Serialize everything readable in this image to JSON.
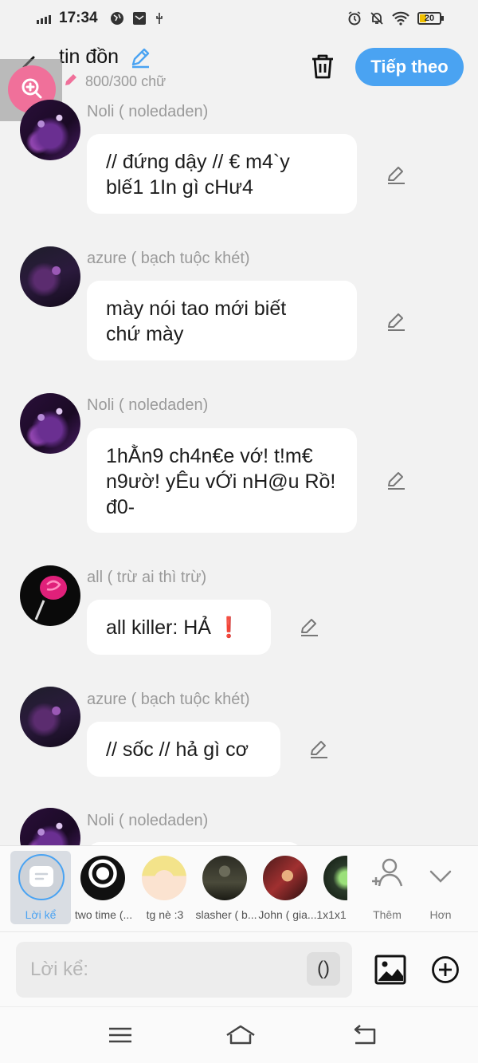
{
  "status_bar": {
    "time": "17:34",
    "battery": "20"
  },
  "header": {
    "title": "tin đồn",
    "char_count": "800/300 chữ",
    "next_label": "Tiếp theo"
  },
  "messages": [
    {
      "name": "Noli ( noledaden)",
      "lines": [
        "// đứng dậy // € m4`y",
        "blế1 1In gì cHư4"
      ]
    },
    {
      "name": "azure ( bạch tuộc khét)",
      "lines": [
        "mày nói tao mới biết",
        "chứ mày"
      ]
    },
    {
      "name": "Noli ( noledaden)",
      "lines": [
        "1hẰn9 ch4n€e vớ! t!m€",
        "n9ườ! yÊu vỚi nH@u Rồ!",
        "đ0-"
      ]
    },
    {
      "name": "all ( trừ ai thì trừ)",
      "lines": [
        "all killer: HẢ ❗"
      ]
    },
    {
      "name": "azure ( bạch tuộc khét)",
      "lines": [
        "// sốc // hả gì cơ"
      ]
    },
    {
      "name": "Noli ( noledaden)",
      "lines": [
        ""
      ]
    }
  ],
  "characters": {
    "narration_label": "Lời kể",
    "items": [
      {
        "label": "two time (...",
        "icon": "two-time-avatar"
      },
      {
        "label": "tg nè :3",
        "icon": "tg-avatar"
      },
      {
        "label": "slasher ( b...",
        "icon": "slasher-avatar"
      },
      {
        "label": "John ( gia...",
        "icon": "john-avatar"
      },
      {
        "label": "1x1x1",
        "icon": "1x1x1-avatar"
      }
    ],
    "add_label": "Thêm",
    "more_label": "Hơn"
  },
  "input": {
    "placeholder": "Lời kể:",
    "paren": "()"
  },
  "colors": {
    "accent": "#4aa3f2",
    "zoom": "#f0709a",
    "background": "#f2f2f2"
  }
}
